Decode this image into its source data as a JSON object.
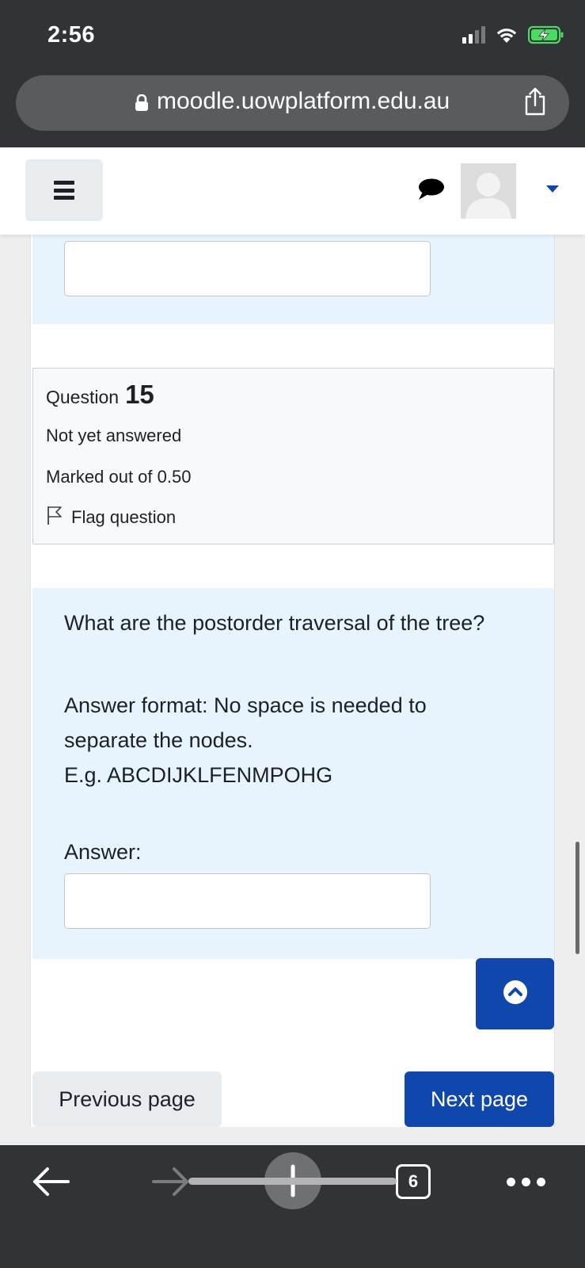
{
  "status_bar": {
    "time": "2:56",
    "icons": [
      "cellular-signal-icon",
      "wifi-icon",
      "battery-charging-icon"
    ],
    "battery_color": "#4cd964"
  },
  "browser": {
    "url": "moodle.uowplatform.edu.au",
    "icons": [
      "lock-icon",
      "share-icon"
    ],
    "toolbar": {
      "tab_count": "6",
      "icons": [
        "back-arrow-icon",
        "forward-arrow-icon",
        "new-tab-plus-icon",
        "tabs-icon",
        "more-dots-icon"
      ]
    }
  },
  "navbar": {
    "icons": [
      "hamburger-menu-icon",
      "chat-bubble-icon",
      "user-avatar",
      "dropdown-caret-icon"
    ]
  },
  "question": {
    "label": "Question",
    "number": "15",
    "state": "Not yet answered",
    "grade": "Marked out of 0.50",
    "flag_label": "Flag question",
    "text": "What are the postorder traversal of the tree?",
    "format_line1": "Answer format: No space is needed to separate the nodes.",
    "format_line2": "E.g. ABCDIJKLFENMPOHG",
    "answer_label": "Answer:",
    "answer_value": ""
  },
  "navigation": {
    "previous_label": "Previous page",
    "next_label": "Next page"
  },
  "colors": {
    "primary": "#0f47ad",
    "formulation_bg": "#e7f3fd",
    "chrome_bg": "#323336"
  }
}
